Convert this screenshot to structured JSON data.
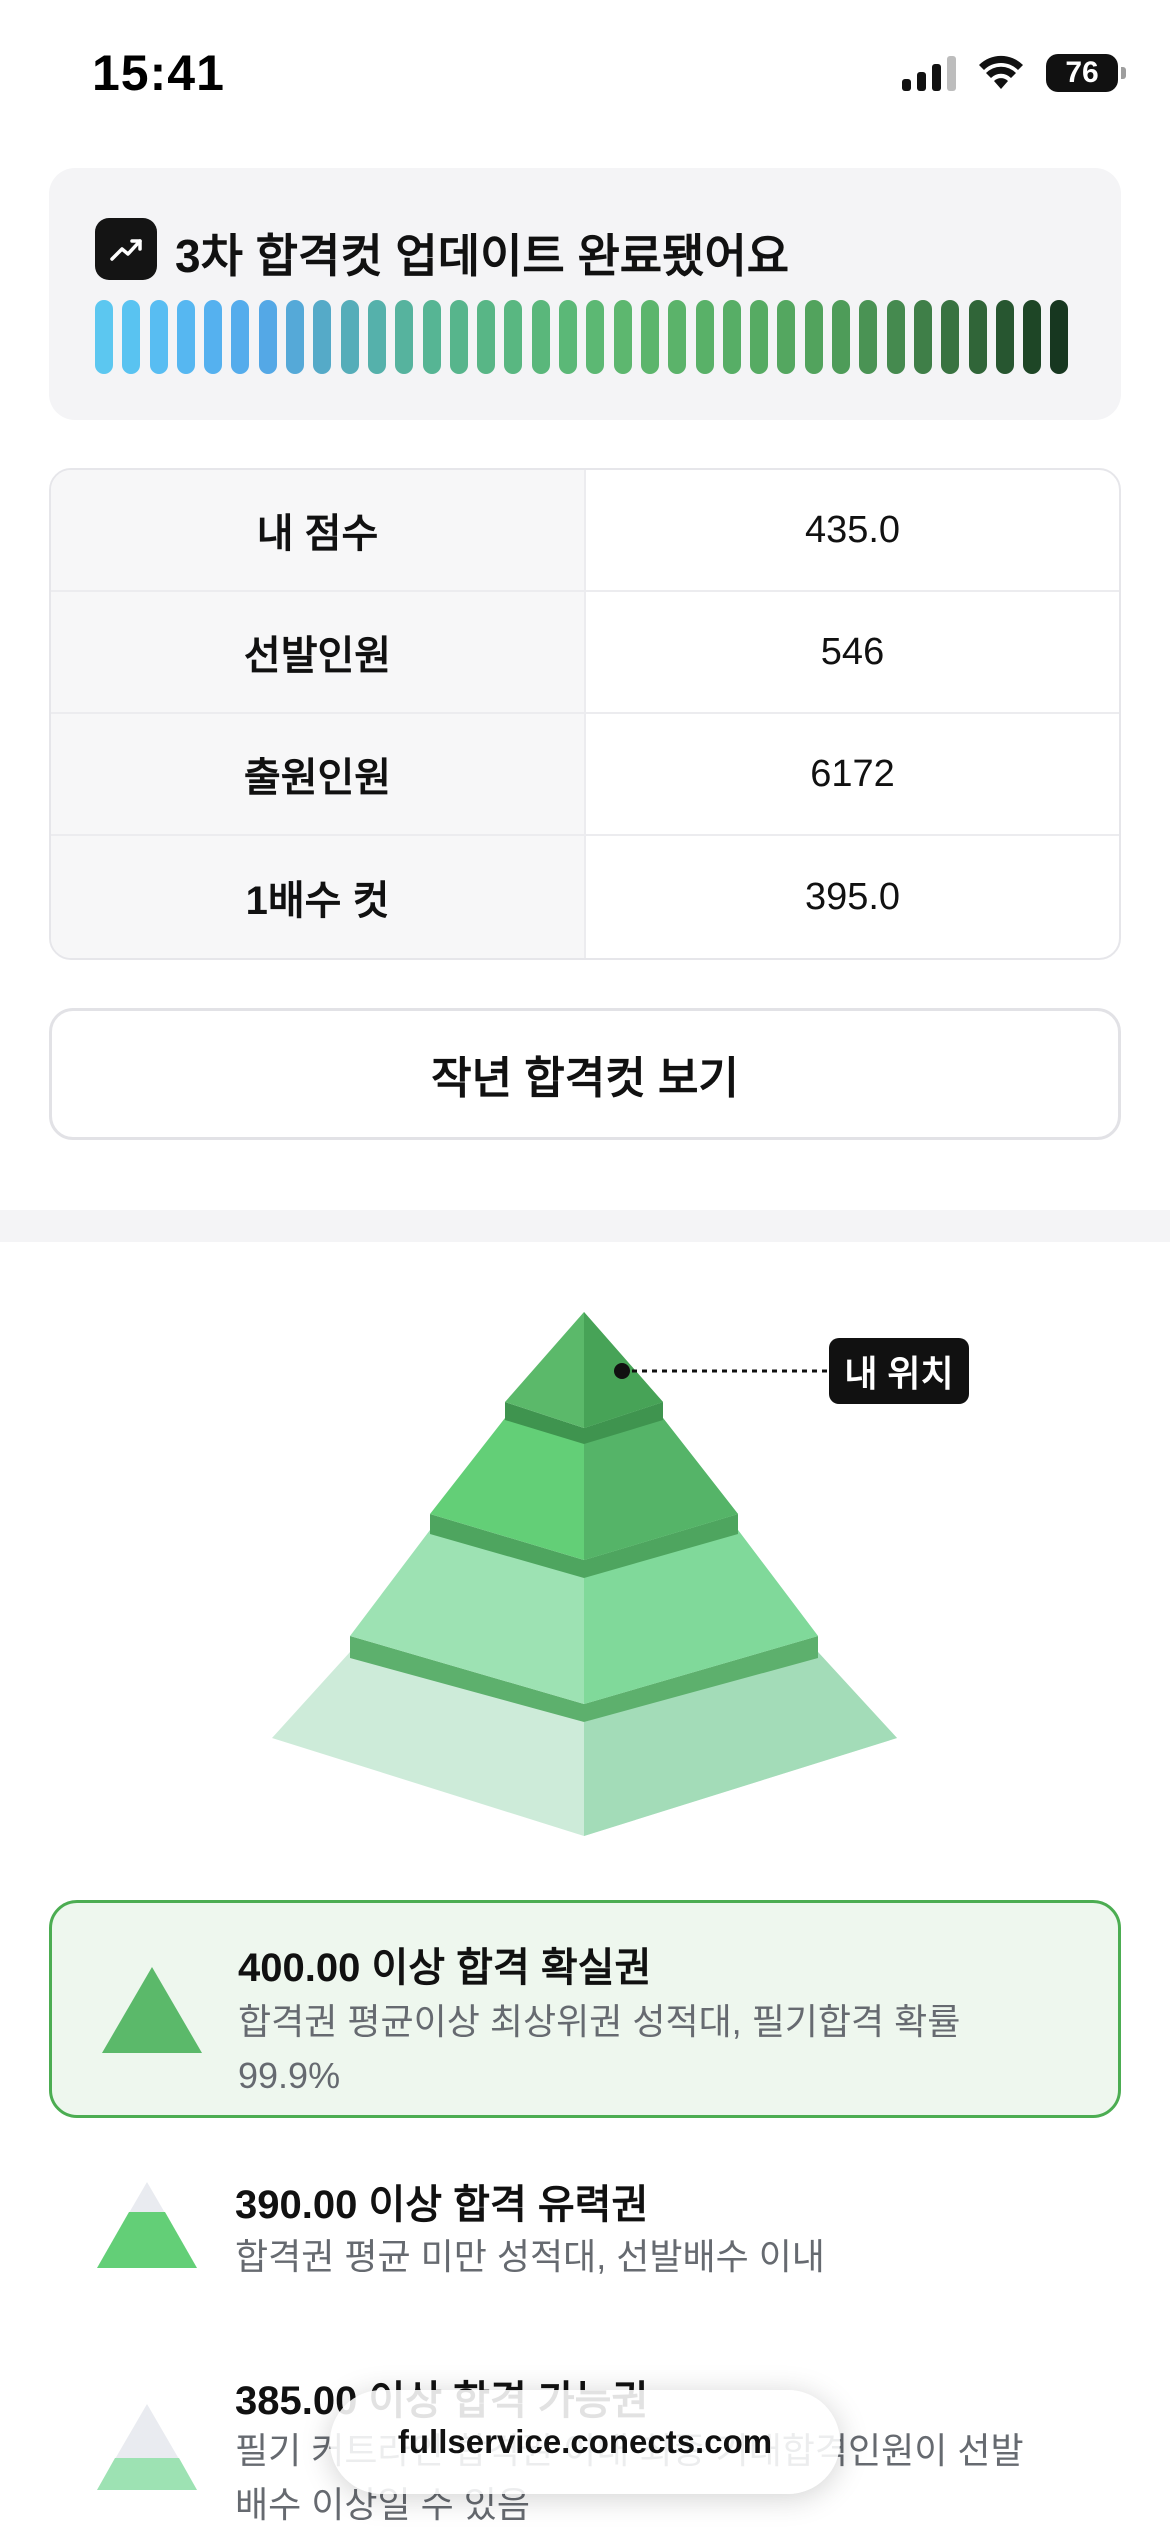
{
  "status_bar": {
    "time": "15:41",
    "battery": "76"
  },
  "banner": {
    "title": "3차 합격컷 업데이트 완료됐어요",
    "bar_colors": [
      "#5cc7f0",
      "#59c3f1",
      "#58bdf2",
      "#56b7f1",
      "#55b1ef",
      "#54acec",
      "#54a8e6",
      "#55a9d8",
      "#55aac8",
      "#55adb9",
      "#55b1ab",
      "#56b39e",
      "#56b594",
      "#57b58c",
      "#58b686",
      "#59b781",
      "#5ab77b",
      "#5bb877",
      "#5cb873",
      "#5db76f",
      "#5cb56c",
      "#5bb36a",
      "#59b168",
      "#57ae66",
      "#56ab63",
      "#54a760",
      "#52a35d",
      "#4e9c59",
      "#4a9354",
      "#458a4f",
      "#3f7f48",
      "#387341",
      "#306538",
      "#275630",
      "#1e4626",
      "#173720"
    ]
  },
  "info_table": {
    "rows": [
      {
        "label": "내 점수",
        "value": "435.0"
      },
      {
        "label": "선발인원",
        "value": "546"
      },
      {
        "label": "출원인원",
        "value": "6172"
      },
      {
        "label": "1배수 컷",
        "value": "395.0"
      }
    ]
  },
  "prev_button": {
    "label": "작년 합격컷 보기"
  },
  "pyramid": {
    "position_tag": "내 위치"
  },
  "levels": [
    {
      "title": "400.00 이상 합격 확실권",
      "desc_line1": "합격권 평균이상 최상위권 성적대, 필기합격 확률",
      "desc_line2": "99.9%"
    },
    {
      "title": "390.00 이상 합격 유력권",
      "desc_line1": "합격권 평균 미만 성적대, 선발배수 이내"
    },
    {
      "title": "385.00 이상 합격 가능권",
      "desc_line1": "필기 커트라인 합격권 이내 최종 기대합격인원이 선발",
      "desc_line2": "배수 이상일 수 있음"
    }
  ],
  "browser": {
    "url": "fullservice.conects.com"
  }
}
